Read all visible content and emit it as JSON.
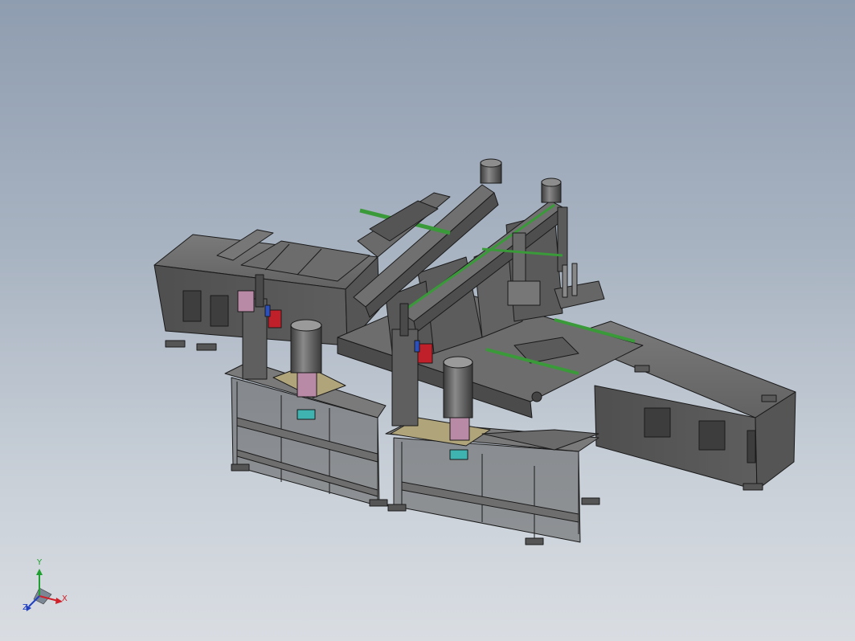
{
  "viewport": {
    "background_top": "#8f9db0",
    "background_bottom": "#d9dde2"
  },
  "model": {
    "frame_color": "#6b6b6b",
    "edge_color": "#1a1a1a",
    "rail_color": "#3a9a3a",
    "accent_red": "#c0202a",
    "accent_blue": "#2a4fbf",
    "accent_teal": "#3fb3b0",
    "accent_pink": "#b98aa6",
    "accent_tan": "#b0a47a"
  },
  "triad": {
    "x_label": "X",
    "y_label": "Y",
    "z_label": "Z",
    "x_color": "#d0202a",
    "y_color": "#20a030",
    "z_color": "#2040c0"
  }
}
